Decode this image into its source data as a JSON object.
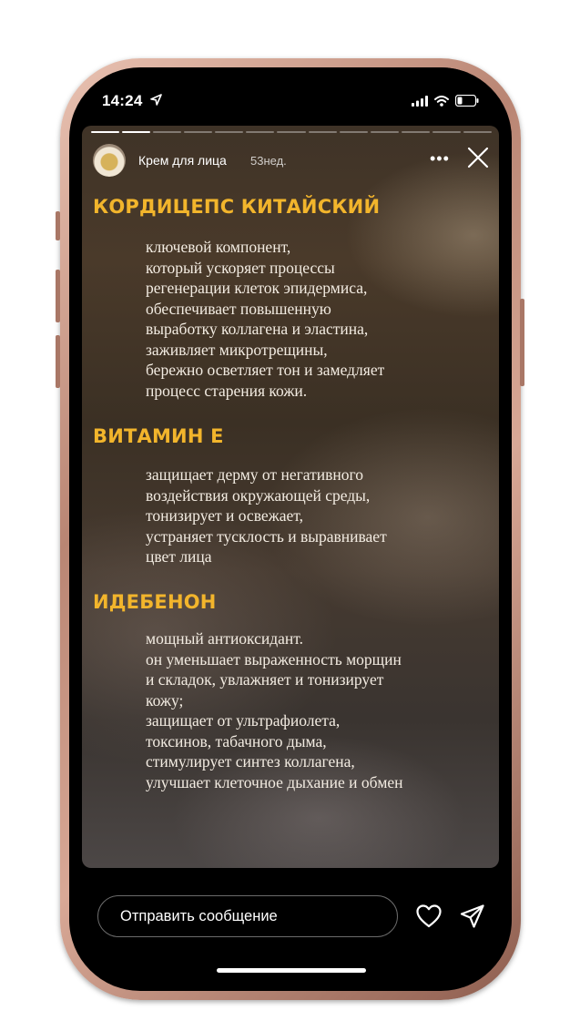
{
  "status_bar": {
    "time": "14:24"
  },
  "story": {
    "segment_count": 13,
    "current_segment": 2,
    "title": "Крем для лица",
    "age": "53нед."
  },
  "content": [
    {
      "heading": "КОРДИЦЕПС КИТАЙСКИЙ",
      "lines": [
        "ключевой компонент,",
        "который ускоряет процессы",
        "регенерации клеток эпидермиса,",
        "обеспечивает повышенную",
        "выработку коллагена и эластина,",
        "заживляет микротрещины,",
        "бережно осветляет тон и замедляет",
        "процесс старения кожи."
      ]
    },
    {
      "heading": "ВИТАМИН Е",
      "lines": [
        "защищает дерму от негативного",
        "воздействия окружающей среды,",
        "тонизирует и освежает,",
        "устраняет тусклость и выравнивает",
        "цвет лица"
      ]
    },
    {
      "heading": "ИДЕБЕНОН",
      "lines": [
        "мощный антиоксидант.",
        "он уменьшает выраженность морщин",
        "и складок, увлажняет и тонизирует",
        "кожу;",
        "защищает от ультрафиолета,",
        "токсинов, табачного дыма,",
        "стимулирует синтез коллагена,",
        "улучшает клеточное дыхание и обмен"
      ]
    }
  ],
  "reply": {
    "placeholder": "Отправить сообщение"
  },
  "icons": {
    "location": "location-arrow-icon",
    "signal": "cellular-signal-icon",
    "wifi": "wifi-icon",
    "battery": "battery-icon",
    "more": "more-options-icon",
    "close": "close-icon",
    "heart": "heart-icon",
    "send": "send-icon"
  },
  "colors": {
    "heading": "#f2b52c",
    "body_text": "#f3ece2",
    "frame": "#c39382"
  }
}
